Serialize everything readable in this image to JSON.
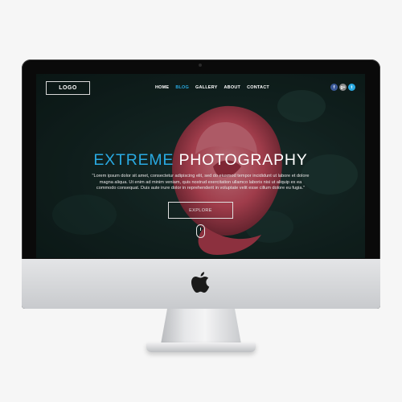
{
  "header": {
    "logo_label": "LOGO",
    "nav": [
      {
        "label": "HOME",
        "active": false
      },
      {
        "label": "BLOG",
        "active": true
      },
      {
        "label": "GALLERY",
        "active": false
      },
      {
        "label": "ABOUT",
        "active": false
      },
      {
        "label": "CONTACT",
        "active": false
      }
    ],
    "social": [
      {
        "icon": "facebook-icon",
        "glyph": "f",
        "color": "#3b5998"
      },
      {
        "icon": "google-plus-icon",
        "glyph": "g+",
        "color": "#8a8a8a"
      },
      {
        "icon": "twitter-icon",
        "glyph": "t",
        "color": "#29a9e1"
      }
    ]
  },
  "hero": {
    "title_accent": "EXTREME",
    "title_main": "PHOTOGRAPHY",
    "tagline": "\"Lorem ipsum dolor sit amet, consectetur adipiscing elit, sed do eiusmod tempor incididunt ut labore et dolore magna aliqua. Ut enim ad minim veniam, quis nostrud exercitation ullamco laboris nisi ut aliquip ex ea commodo consequat. Duis aute irure dolor in reprehenderit in voluptate velit esse cillum dolore eu fugia.\"",
    "cta_label": "EXPLORE"
  },
  "colors": {
    "accent": "#29a9e1",
    "rose": "#d24a5d",
    "background": "#142522"
  }
}
